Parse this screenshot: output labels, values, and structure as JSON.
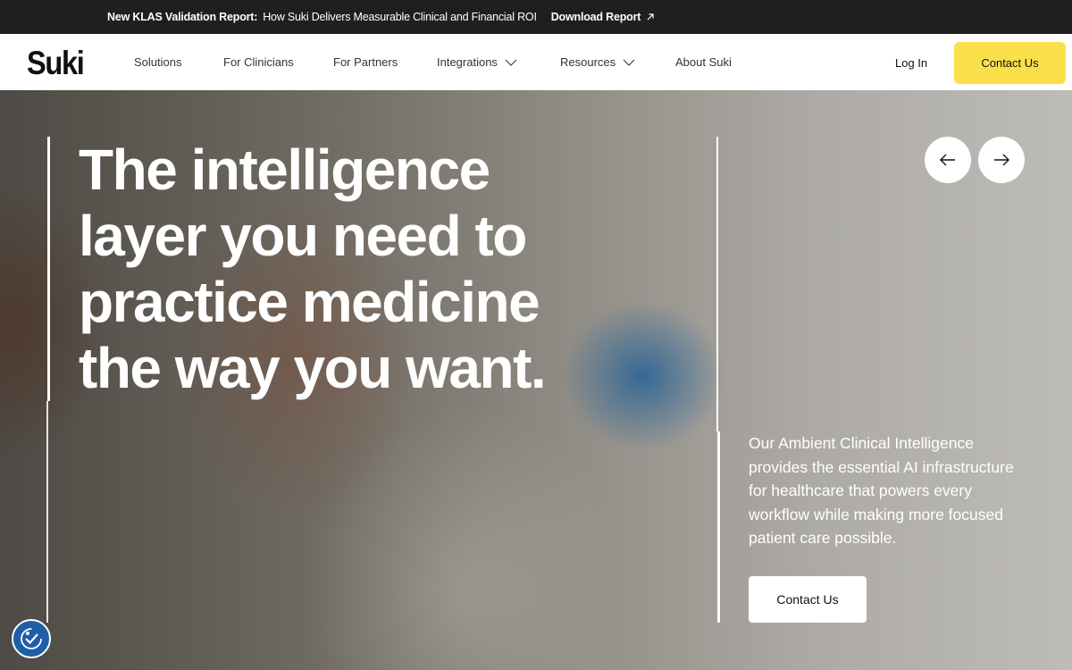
{
  "announcement": {
    "bold": "New KLAS Validation Report:",
    "text": "How Suki Delivers Measurable Clinical and Financial ROI",
    "link": "Download Report",
    "link_icon": "arrow-up-right-icon"
  },
  "nav": {
    "logo": "Suki",
    "items": [
      {
        "label": "Solutions",
        "dropdown": false
      },
      {
        "label": "For Clinicians",
        "dropdown": false
      },
      {
        "label": "For Partners",
        "dropdown": false
      },
      {
        "label": "Integrations",
        "dropdown": true
      },
      {
        "label": "Resources",
        "dropdown": true
      },
      {
        "label": "About Suki",
        "dropdown": false
      }
    ],
    "login": "Log In",
    "contact": "Contact Us"
  },
  "hero": {
    "headline_lines": [
      "The intelligence",
      "layer you need to",
      "practice medicine",
      "the way you want."
    ],
    "description": "Our Ambient Clinical Intelligence provides the essential AI infrastructure for healthcare that powers every workflow while making more focused patient care possible.",
    "cta": "Contact Us",
    "prev_icon": "arrow-left-icon",
    "next_icon": "arrow-right-icon"
  },
  "colors": {
    "announcement_bg": "#1f1f1f",
    "cta_yellow": "#f9e04b",
    "a11y_blue": "#1f5fa8"
  }
}
